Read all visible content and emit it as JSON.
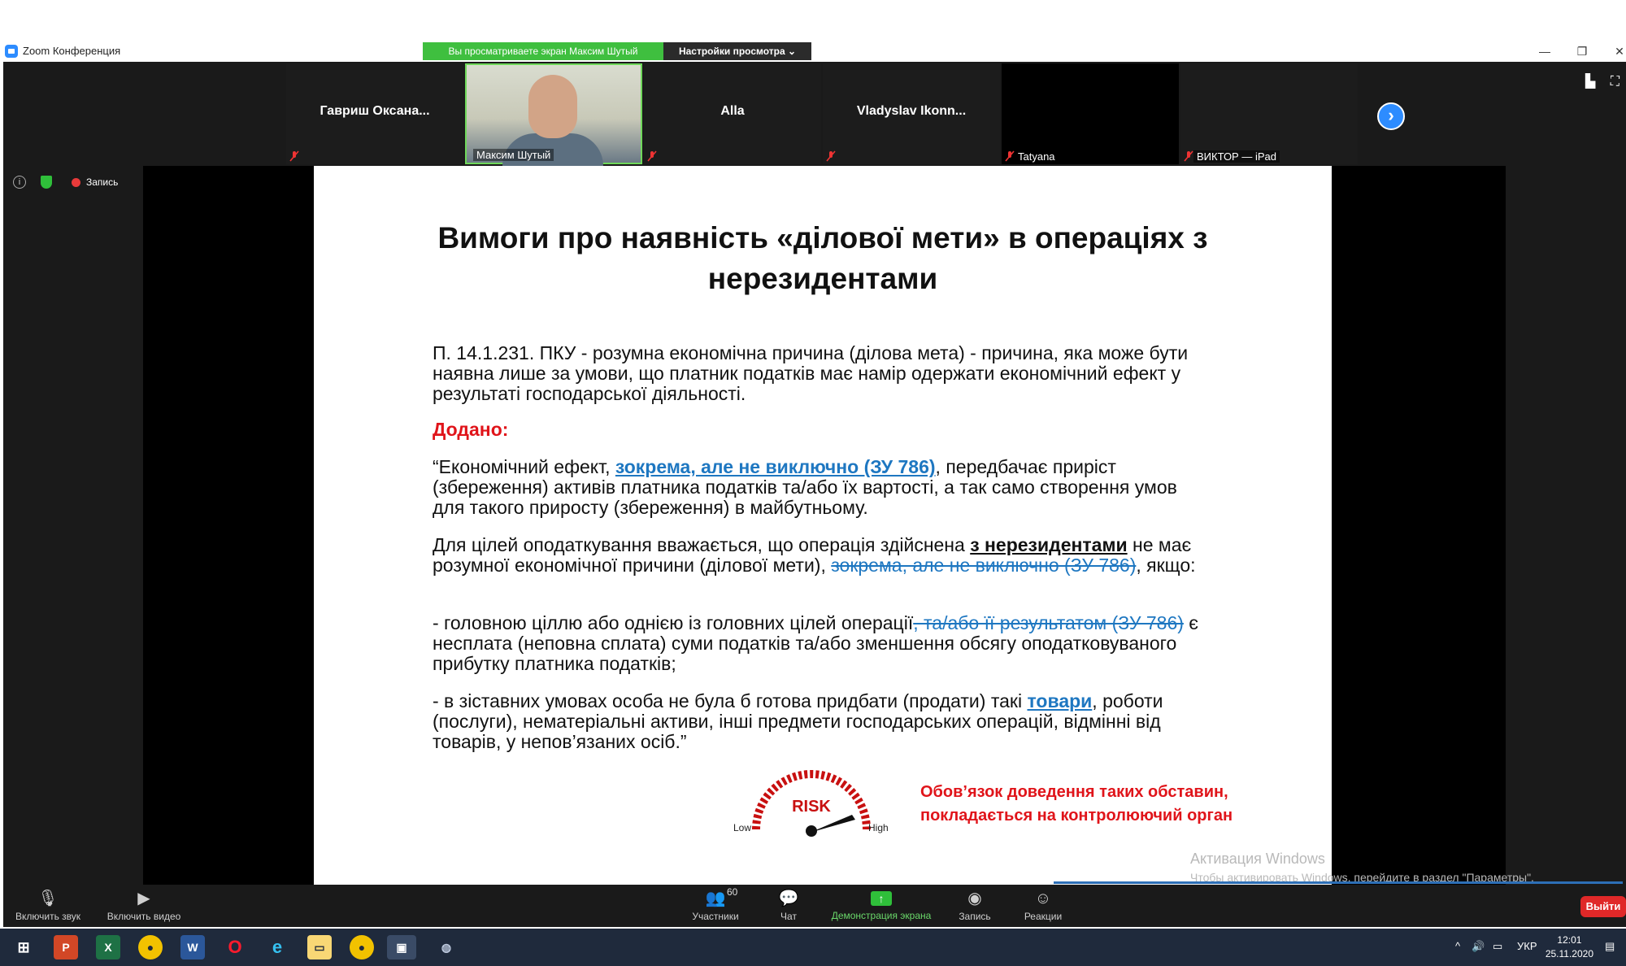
{
  "window": {
    "title": "Zoom Конференция",
    "share_banner": "Вы просматриваете экран Максим Шутый",
    "view_options": "Настройки просмотра ⌄"
  },
  "participants": [
    {
      "name": "Гавриш Оксана...",
      "muted": true
    },
    {
      "name": "Максим Шутый",
      "video": true
    },
    {
      "name": "Alla",
      "muted": true
    },
    {
      "name": "Vladyslav Ikonn...",
      "muted": true
    },
    {
      "name": "Tatyana",
      "muted": true
    },
    {
      "name": "ВИКТОР — iPad",
      "muted": true
    }
  ],
  "status": {
    "recording_label": "Запись"
  },
  "slide": {
    "title": "Вимоги про наявність «ділової мети» в операціях з нерезидентами",
    "p1": "П. 14.1.231. ПКУ - розумна економічна причина (ділова мета) - причина, яка може бути наявна лише за умови, що платник податків має намір одержати економічний ефект у результаті господарської діяльності.",
    "added": "Додано:",
    "p2_a": "“Економічний ефект, ",
    "p2_link": "зокрема, але не виключно (ЗУ 786)",
    "p2_b": ", передбачає приріст (збереження) активів платника податків та/або їх вартості, а так само створення умов для такого приросту (збереження) в майбутньому.",
    "p3_a": "Для цілей оподаткування вважається, що операція здійснена ",
    "p3_bold": "з нерезидентами",
    "p3_b": " не має розумної економічної причини (ділової мети), ",
    "p3_strike": "зокрема, але не виключно (ЗУ 786)",
    "p3_c": ", якщо:",
    "p4_a": "- головною ціллю або однією із головних цілей операції",
    "p4_strike": ", та/або її результатом (ЗУ 786)",
    "p4_b": " є несплата (неповна сплата) суми податків та/або зменшення обсягу оподатковуваного прибутку платника податків;",
    "p5_a": "- в зіставних умовах особа не була б готова придбати (продати) такі ",
    "p5_link": "товари",
    "p5_b": ", роботи (послуги), нематеріальні активи, інші предмети господарських операцій, відмінні від товарів, у непов’язаних осіб.”",
    "gauge_risk": "RISK",
    "gauge_low": "Low",
    "gauge_high": "High",
    "risk_note": "Обов’язок доведення таких обставин, покладається на контролюючий орган"
  },
  "watermark": {
    "line1": "Активация Windows",
    "line2": "Чтобы активировать Windows, перейдите в раздел \"Параметры\"."
  },
  "toolbar": {
    "mic": "Включить звук",
    "video": "Включить видео",
    "participants": "Участники",
    "participants_count": "60",
    "chat": "Чат",
    "share": "Демонстрация экрана",
    "record": "Запись",
    "reactions": "Реакции",
    "leave": "Выйти"
  },
  "taskbar": {
    "lang": "УКР",
    "time": "12:01",
    "date": "25.11.2020"
  },
  "colors": {
    "share_green": "#3fbf3f",
    "link_blue": "#1e77c1",
    "alert_red": "#e0141a",
    "zoom_blue": "#2d8cff"
  }
}
